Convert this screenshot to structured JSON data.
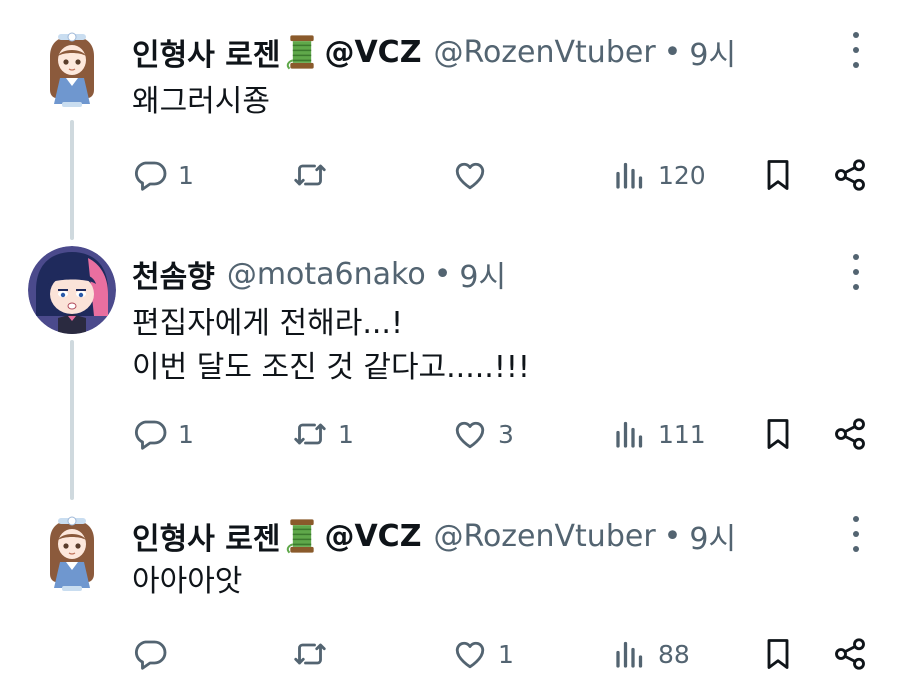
{
  "tweets": [
    {
      "name": "인형사 로젠",
      "handle_suffix": "@VCZ",
      "username": "@RozenVtuber",
      "separator": "•",
      "time": "9시",
      "text": "왜그러시죵",
      "counts": {
        "replies": "1",
        "retweets": "",
        "likes": "",
        "views": "120"
      }
    },
    {
      "name": "천솜향",
      "handle_suffix": "",
      "username": "@mota6nako",
      "separator": "•",
      "time": "9시",
      "text": "편집자에게 전해라...!\n이번 달도 조진 것 같다고.....!!!",
      "counts": {
        "replies": "1",
        "retweets": "1",
        "likes": "3",
        "views": "111"
      }
    },
    {
      "name": "인형사 로젠",
      "handle_suffix": "@VCZ",
      "username": "@RozenVtuber",
      "separator": "•",
      "time": "9시",
      "text": "아아아앗",
      "counts": {
        "replies": "",
        "retweets": "",
        "likes": "1",
        "views": "88"
      }
    }
  ],
  "icons": {
    "reply": "reply-icon",
    "retweet": "retweet-icon",
    "like": "heart-icon",
    "views": "views-icon",
    "bookmark": "bookmark-icon",
    "share": "share-icon",
    "more": "more-icon",
    "spool": "thread-spool-icon"
  },
  "colors": {
    "text": "#0f1419",
    "secondary": "#536471",
    "thread_line": "#cfd9de"
  }
}
